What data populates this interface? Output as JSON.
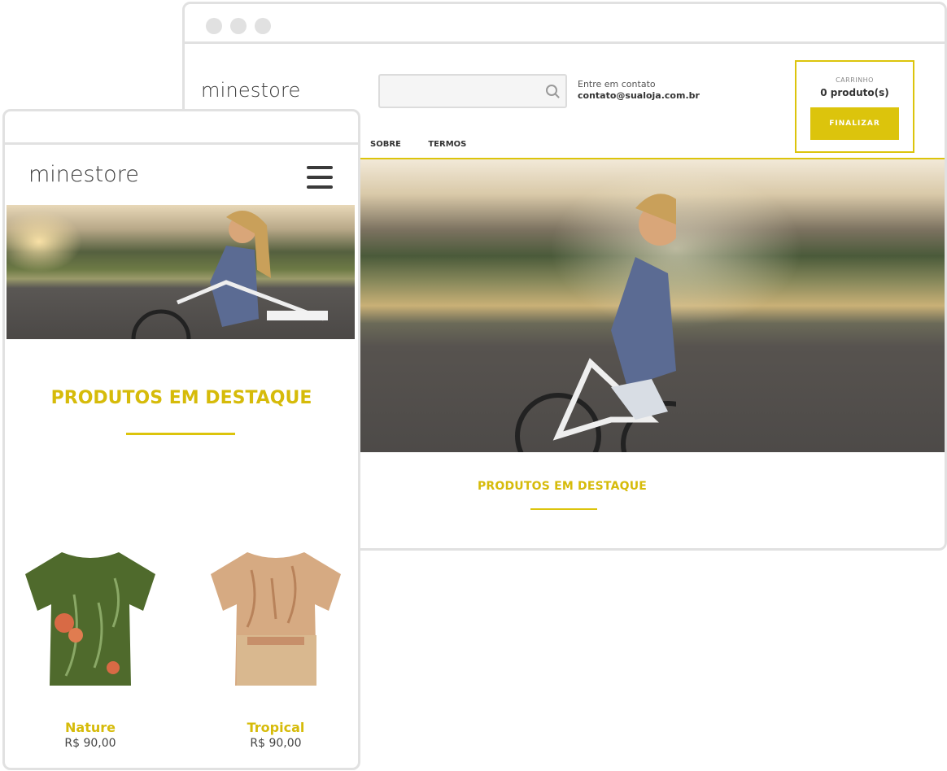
{
  "desktop": {
    "logo": "minestore",
    "search": {
      "placeholder": ""
    },
    "contact": {
      "label": "Entre em contato",
      "email": "contato@sualoja.com.br"
    },
    "cart": {
      "label": "CARRINHO",
      "count": "0 produto(s)",
      "button": "FINALIZAR"
    },
    "nav": [
      "SOBRE",
      "TERMOS"
    ],
    "featured_title": "PRODUTOS EM DESTAQUE"
  },
  "mobile": {
    "logo": "minestore",
    "featured_title": "PRODUTOS EM DESTAQUE",
    "products": [
      {
        "name": "Nature",
        "price": "R$ 90,00",
        "image": "green-floral-tshirt"
      },
      {
        "name": "Tropical",
        "price": "R$ 90,00",
        "image": "beige-tropical-tshirt"
      }
    ]
  },
  "colors": {
    "accent": "#dcc40c",
    "frame": "#e1e1e1",
    "text": "#333333"
  }
}
